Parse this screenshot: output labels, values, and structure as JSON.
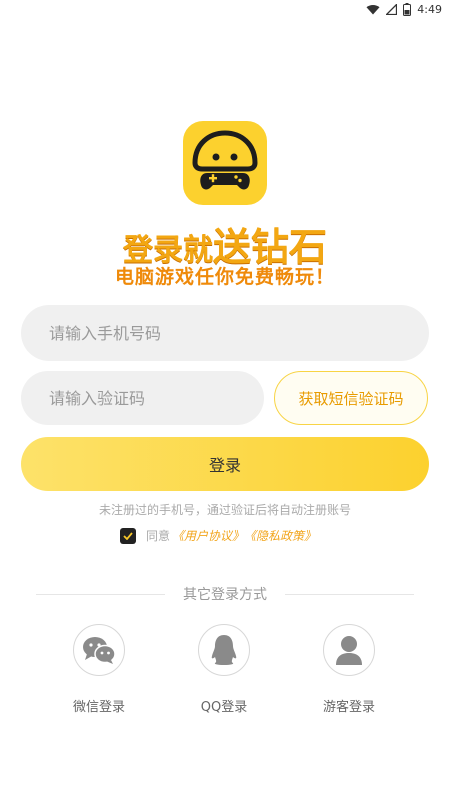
{
  "status_bar": {
    "time": "4:49"
  },
  "brand": {
    "logo_icon": "mushroom-gamepad-logo-icon",
    "color_primary": "#fcd12e",
    "color_accent": "#f3a712"
  },
  "headline": {
    "part1": "登录就",
    "part2": "送钻石"
  },
  "subheadline": "电脑游戏任你免费畅玩！",
  "form": {
    "phone_placeholder": "请输入手机号码",
    "code_placeholder": "请输入验证码",
    "get_code_label": "获取短信验证码",
    "login_label": "登录"
  },
  "hint": "未注册过的手机号，通过验证后将自动注册账号",
  "agreement": {
    "checked": true,
    "prefix": "同意",
    "user_agreement": "《用户协议》",
    "privacy_policy": "《隐私政策》"
  },
  "other_login": {
    "title": "其它登录方式",
    "options": [
      {
        "label": "微信登录",
        "icon": "wechat-icon"
      },
      {
        "label": "QQ登录",
        "icon": "qq-penguin-icon"
      },
      {
        "label": "游客登录",
        "icon": "guest-user-icon"
      }
    ]
  }
}
